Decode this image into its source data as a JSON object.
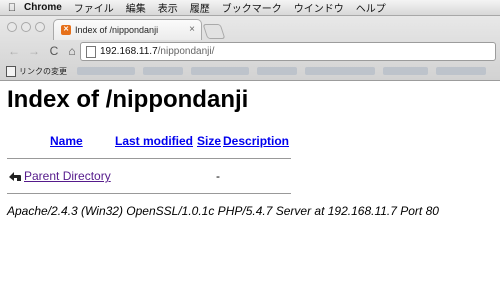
{
  "menubar": {
    "app": "Chrome",
    "items": [
      "ファイル",
      "編集",
      "表示",
      "履歴",
      "ブックマーク",
      "ウインドウ",
      "ヘルプ"
    ]
  },
  "tab": {
    "title": "Index of /nippondanji",
    "close": "×"
  },
  "nav": {
    "back": "←",
    "forward": "→",
    "reload": "C",
    "home": "⌂"
  },
  "omnibox": {
    "host": "192.168.11.7",
    "path": "/nippondanji/"
  },
  "bookmarks": {
    "first_label": "リンクの変更"
  },
  "page": {
    "title": "Index of /nippondanji",
    "columns": {
      "name": "Name",
      "last_modified": "Last modified",
      "size": "Size",
      "description": "Description"
    },
    "rows": [
      {
        "name": "Parent Directory",
        "size": "-"
      }
    ],
    "server_signature": "Apache/2.4.3 (Win32) OpenSSL/1.0.1c PHP/5.4.7 Server at 192.168.11.7 Port 80"
  }
}
